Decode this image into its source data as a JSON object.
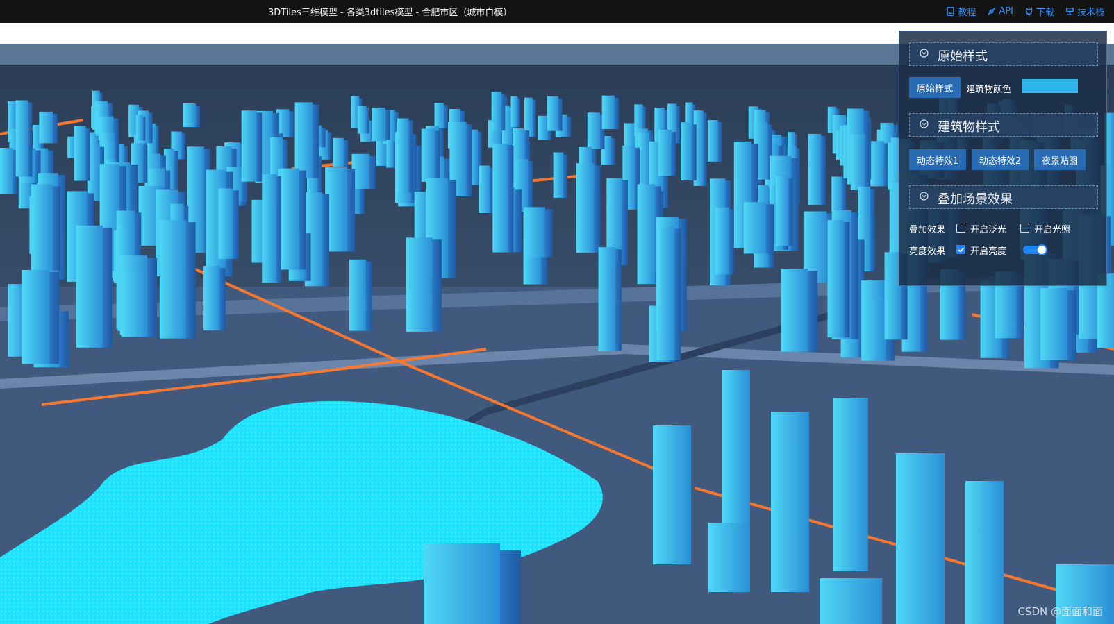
{
  "header": {
    "title": "3DTiles三维模型 - 各类3dtiles模型 - 合肥市区（城市白模）",
    "links": [
      {
        "label": "教程",
        "icon": "book-icon"
      },
      {
        "label": "API",
        "icon": "api-icon"
      },
      {
        "label": "下载",
        "icon": "github-icon"
      },
      {
        "label": "技术栈",
        "icon": "stack-icon"
      }
    ]
  },
  "panel": {
    "sections": [
      {
        "title": "原始样式",
        "icon": "chevron-down-icon"
      },
      {
        "title": "建筑物样式",
        "icon": "chevron-down-icon"
      },
      {
        "title": "叠加场景效果",
        "icon": "chevron-down-icon"
      }
    ],
    "original": {
      "button": "原始样式",
      "color_label": "建筑物颜色",
      "color_value": "#2fb7ec"
    },
    "building_buttons": [
      "动态特效1",
      "动态特效2",
      "夜景贴图"
    ],
    "overlay": {
      "label": "叠加效果",
      "bloom": {
        "label": "开启泛光",
        "checked": false
      },
      "lighting": {
        "label": "开启光照",
        "checked": false
      }
    },
    "brightness": {
      "label": "亮度效果",
      "checkbox": {
        "label": "开启亮度",
        "checked": true
      },
      "slider_value_percent": 78
    }
  },
  "watermark": "CSDN @面面和面",
  "colors": {
    "building": "#3fc8ee",
    "lake": "#1fe4ff",
    "road_glow": "#ff7a2e",
    "ground": "#3d5577",
    "accent": "#1e86ff"
  }
}
